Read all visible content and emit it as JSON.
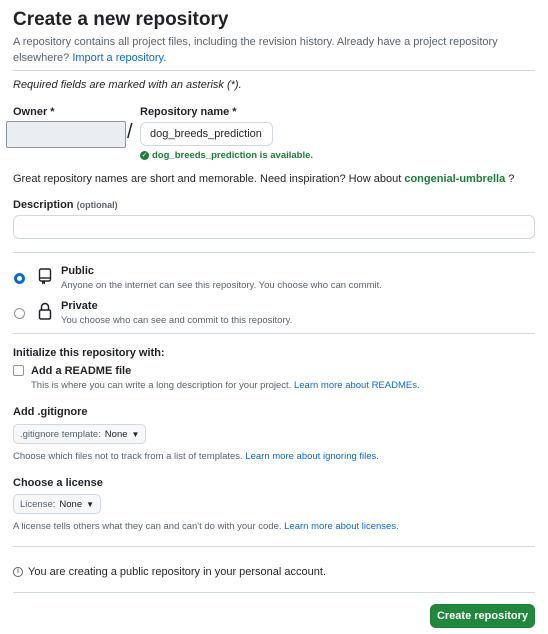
{
  "page": {
    "title": "Create a new repository",
    "intro_text": "A repository contains all project files, including the revision history. Already have a project repository elsewhere?",
    "import_link": "Import a repository.",
    "required_note": "Required fields are marked with an asterisk (*)."
  },
  "owner": {
    "label": "Owner *",
    "value": ""
  },
  "repo": {
    "separator": "/",
    "label": "Repository name *",
    "value": "dog_breeds_prediction",
    "availability": "dog_breeds_prediction is available."
  },
  "suggestion": {
    "text": "Great repository names are short and memorable. Need inspiration? How about",
    "name": "congenial-umbrella",
    "suffix": "?"
  },
  "description": {
    "label": "Description",
    "optional": "(optional)",
    "value": ""
  },
  "visibility": {
    "selected": "public",
    "public": {
      "title": "Public",
      "desc": "Anyone on the internet can see this repository. You choose who can commit."
    },
    "private": {
      "title": "Private",
      "desc": "You choose who can see and commit to this repository."
    }
  },
  "initialize": {
    "title": "Initialize this repository with:",
    "readme_label": "Add a README file",
    "readme_checked": false,
    "readme_desc": "This is where you can write a long description for your project.",
    "readme_link": "Learn more about READMEs."
  },
  "gitignore": {
    "title": "Add .gitignore",
    "select_label": ".gitignore template:",
    "select_value": "None",
    "desc": "Choose which files not to track from a list of templates.",
    "link": "Learn more about ignoring files."
  },
  "license": {
    "title": "Choose a license",
    "select_label": "License:",
    "select_value": "None",
    "desc": "A license tells others what they can and can't do with your code.",
    "link": "Learn more about licenses."
  },
  "info": {
    "text": "You are creating a public repository in your personal account."
  },
  "submit": {
    "label": "Create repository"
  },
  "icons": {
    "repo": "repo-icon",
    "lock": "lock-icon",
    "info": "info-icon",
    "check": "check-circle-icon",
    "caret": "triangle-down-icon"
  },
  "colors": {
    "accent": "#0969da",
    "success": "#1a7f37",
    "button": "#1f883d"
  }
}
